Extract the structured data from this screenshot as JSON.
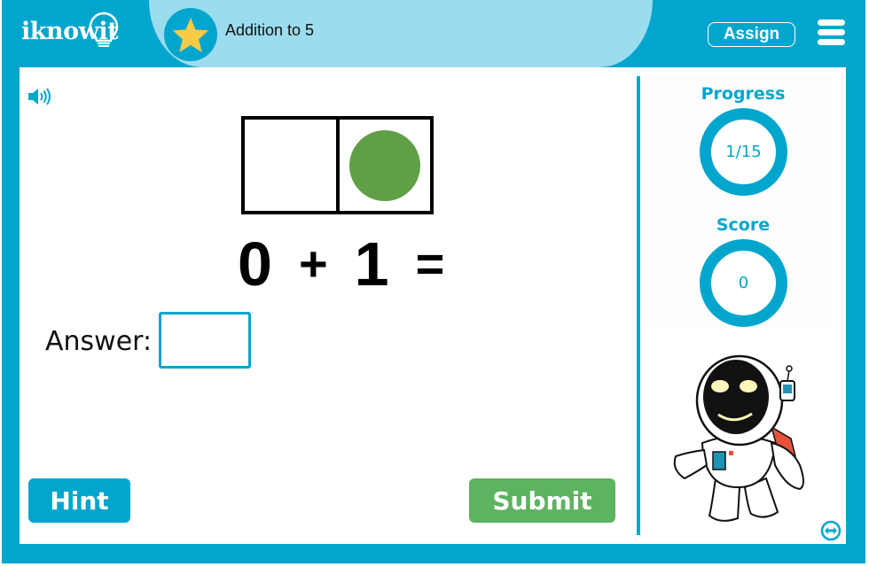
{
  "header": {
    "logo": "iknowit",
    "lesson_title": "Addition to 5",
    "assign_label": "Assign",
    "badge_icon": "star-icon",
    "menu_icon": "hamburger-menu-icon"
  },
  "question": {
    "audio_icon": "speaker-icon",
    "ten_frame": {
      "cells": 2,
      "filled": [
        false,
        true
      ],
      "counter_color": "#5fa046"
    },
    "equation": {
      "a": "0",
      "op": "+",
      "b": "1",
      "eq": "="
    },
    "answer_label": "Answer:",
    "answer_value": ""
  },
  "buttons": {
    "hint": "Hint",
    "submit": "Submit"
  },
  "sidebar": {
    "progress_label": "Progress",
    "progress_value": "1/15",
    "score_label": "Score",
    "score_value": "0",
    "mascot": "astronaut-robot",
    "expand_icon": "expand-arrows-icon"
  },
  "colors": {
    "brand": "#02a6cd",
    "header_pill": "#9bdcee",
    "star": "#f7cb46",
    "submit": "#5cb360"
  }
}
